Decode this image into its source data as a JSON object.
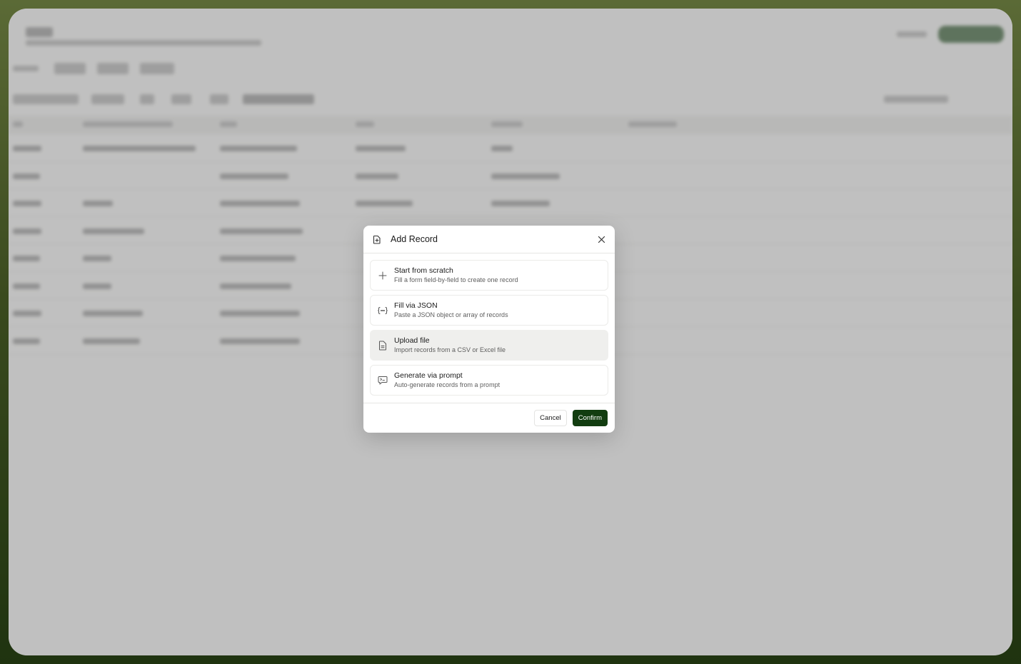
{
  "modal": {
    "title": "Add Record",
    "options": [
      {
        "icon": "plus-icon",
        "title": "Start from scratch",
        "description": "Fill a form field-by-field to create one record"
      },
      {
        "icon": "braces-icon",
        "title": "Fill via JSON",
        "description": "Paste a JSON object or array of records"
      },
      {
        "icon": "file-icon",
        "title": "Upload file",
        "description": "Import records from a CSV or Excel file"
      },
      {
        "icon": "prompt-icon",
        "title": "Generate via prompt",
        "description": "Auto-generate records from a prompt"
      }
    ],
    "cancel_label": "Cancel",
    "confirm_label": "Confirm"
  },
  "colors": {
    "accent": "#123d10",
    "active_option": "#efefed",
    "overlay": "#969696"
  }
}
